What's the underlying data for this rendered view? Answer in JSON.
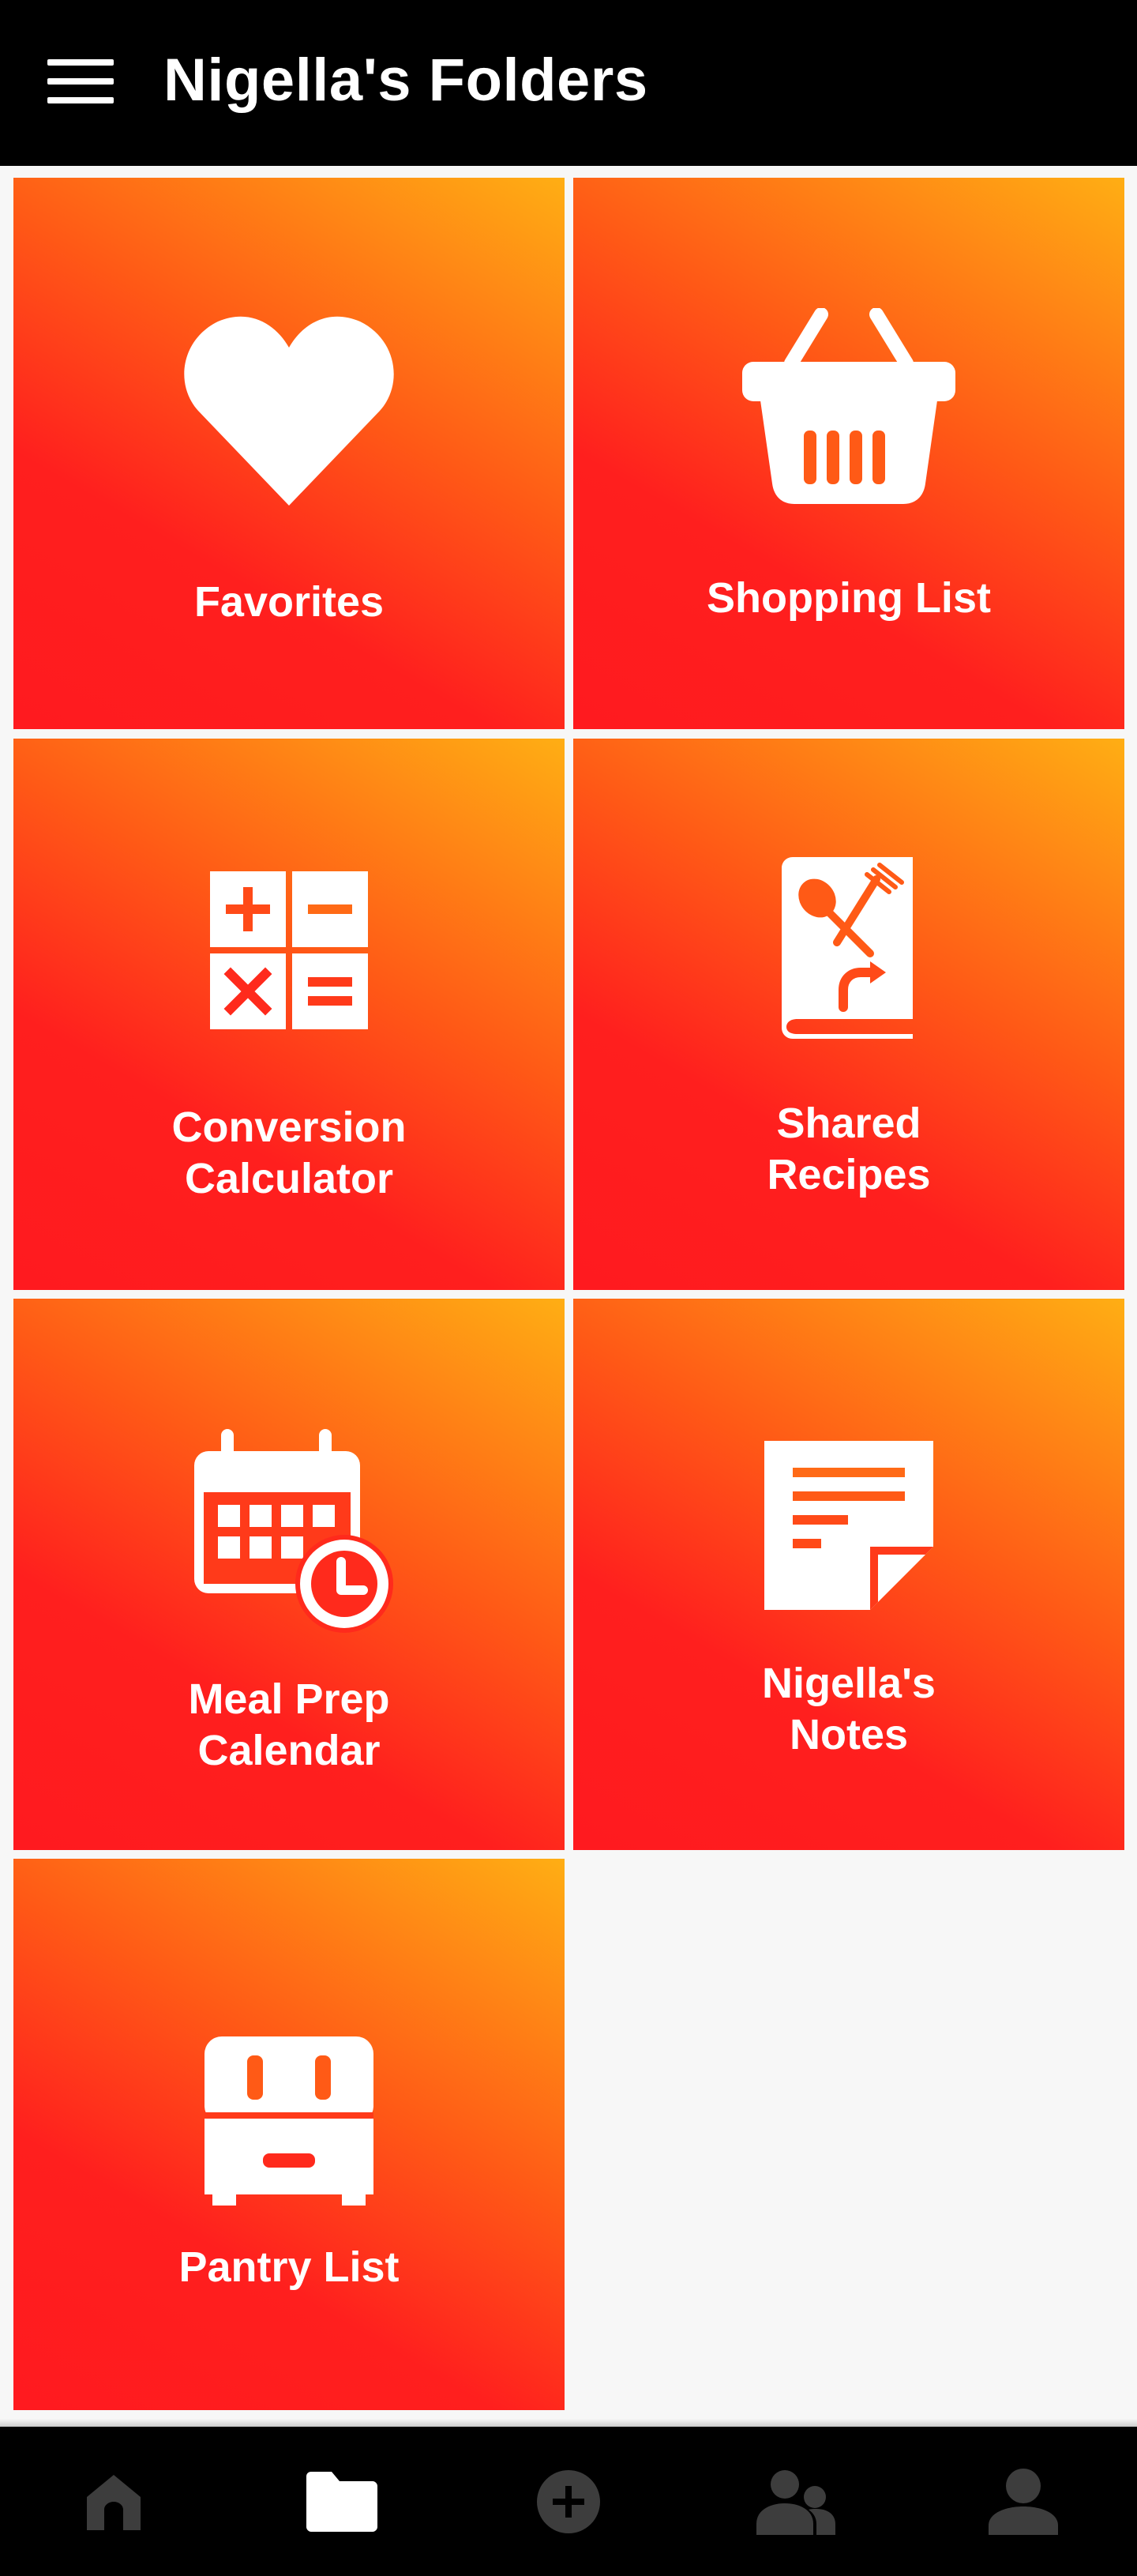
{
  "appbar": {
    "title": "Nigella's Folders",
    "menu_icon": "hamburger-menu-icon"
  },
  "colors": {
    "appbar_bg": "#000000",
    "tile_gradient_start": "#ff1a1f",
    "tile_gradient_end": "#ffae14",
    "page_bg": "#f7f7f7",
    "nav_active": "#ffffff",
    "nav_inactive": "#3d3d3d"
  },
  "folders": [
    {
      "label": "Favorites",
      "icon": "heart-icon"
    },
    {
      "label": "Shopping List",
      "icon": "basket-icon"
    },
    {
      "label": "Conversion\nCalculator",
      "icon": "calculator-icon"
    },
    {
      "label": "Shared\nRecipes",
      "icon": "shared-recipe-book-icon"
    },
    {
      "label": "Meal Prep\nCalendar",
      "icon": "calendar-clock-icon"
    },
    {
      "label": "Nigella's\nNotes",
      "icon": "note-icon"
    },
    {
      "label": "Pantry List",
      "icon": "pantry-cabinet-icon"
    }
  ],
  "bottom_nav": [
    {
      "icon": "home-icon",
      "active": false
    },
    {
      "icon": "folder-icon",
      "active": true
    },
    {
      "icon": "add-circle-icon",
      "active": false
    },
    {
      "icon": "people-icon",
      "active": false
    },
    {
      "icon": "profile-icon",
      "active": false
    }
  ]
}
